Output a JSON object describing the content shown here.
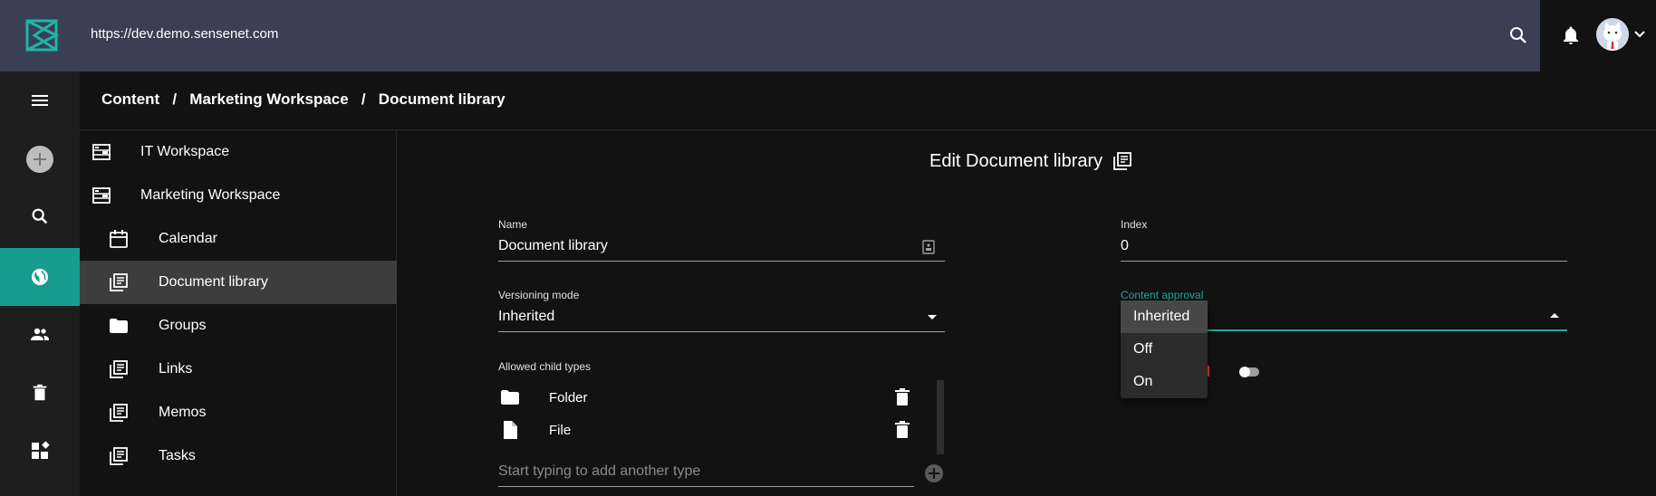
{
  "topbar": {
    "url": "https://dev.demo.sensenet.com",
    "icons": [
      "sensenet-logo-icon",
      "search-icon",
      "bell-icon",
      "user-avatar",
      "chevron-down-icon"
    ]
  },
  "rail": {
    "items": [
      {
        "name": "menu-icon"
      },
      {
        "name": "add-icon"
      },
      {
        "name": "search-icon"
      },
      {
        "name": "globe-icon",
        "active": true
      },
      {
        "name": "users-icon"
      },
      {
        "name": "trash-icon"
      },
      {
        "name": "widgets-icon"
      }
    ],
    "accent": "#179c8f"
  },
  "breadcrumb": {
    "items": [
      "Content",
      "Marketing Workspace",
      "Document library"
    ],
    "separator": "/"
  },
  "tree": {
    "items": [
      {
        "label": "IT Workspace",
        "icon": "workspace-icon"
      },
      {
        "label": "Marketing Workspace",
        "icon": "workspace-icon"
      },
      {
        "label": "Calendar",
        "icon": "calendar-icon"
      },
      {
        "label": "Document library",
        "icon": "library-icon",
        "selected": true
      },
      {
        "label": "Groups",
        "icon": "folder-icon"
      },
      {
        "label": "Links",
        "icon": "library-icon"
      },
      {
        "label": "Memos",
        "icon": "library-icon"
      },
      {
        "label": "Tasks",
        "icon": "library-icon"
      }
    ]
  },
  "form": {
    "title": "Edit Document library",
    "name": {
      "label": "Name",
      "value": "Document library"
    },
    "index": {
      "label": "Index",
      "value": "0"
    },
    "versioning": {
      "label": "Versioning mode",
      "value": "Inherited"
    },
    "content_approval": {
      "label": "Content approval"
    },
    "allowed_child_types": {
      "label": "Allowed child types",
      "items": [
        {
          "label": "Folder",
          "icon": "folder-icon"
        },
        {
          "label": "File",
          "icon": "file-icon"
        }
      ],
      "placeholder": "Start typing to add another type"
    }
  },
  "approval_menu": {
    "options": [
      "Inherited",
      "Off",
      "On"
    ],
    "selected": "Inherited"
  }
}
